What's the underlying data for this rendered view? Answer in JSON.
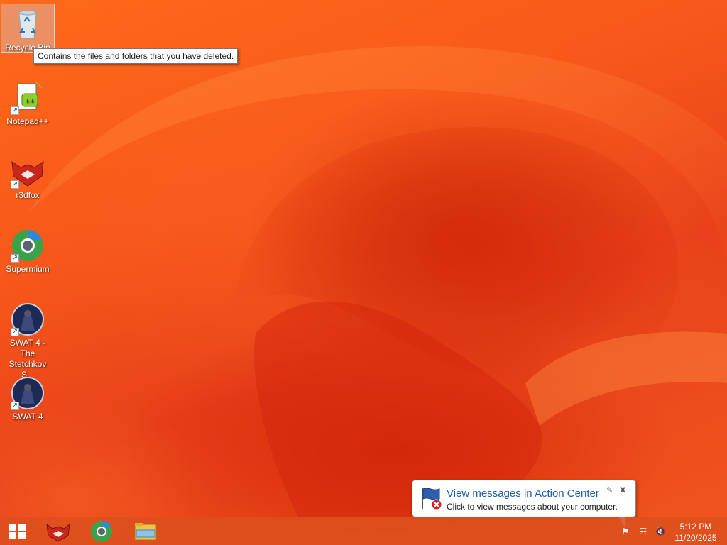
{
  "desktop": {
    "icons": [
      {
        "label": "Recycle Bin",
        "icon": "recycle-bin-icon",
        "selected": true
      },
      {
        "label": "Notepad++",
        "icon": "notepad-plus-plus-icon"
      },
      {
        "label": "r3dfox",
        "icon": "r3dfox-icon"
      },
      {
        "label": "Supermium",
        "icon": "supermium-icon"
      },
      {
        "label": "SWAT 4 - The Stetchkov S...",
        "icon": "swat4-icon"
      },
      {
        "label": "SWAT 4",
        "icon": "swat4-icon"
      }
    ],
    "tooltip": "Contains the files and folders that you have deleted."
  },
  "notification": {
    "title": "View messages in Action Center",
    "text": "Click to view messages about your computer.",
    "icon": "action-center-flag-icon",
    "close_glyph": "x"
  },
  "taskbar": {
    "start_icon": "windows-logo-icon",
    "pinned": [
      {
        "name": "r3dfox",
        "icon": "r3dfox-icon"
      },
      {
        "name": "Supermium",
        "icon": "supermium-icon"
      },
      {
        "name": "File Explorer",
        "icon": "file-explorer-icon"
      }
    ],
    "tray": [
      {
        "icon": "action-center-flag-icon"
      },
      {
        "icon": "network-icon"
      },
      {
        "icon": "volume-muted-icon"
      }
    ],
    "clock": {
      "time": "5:12 PM",
      "date": "11/20/2025"
    }
  },
  "colors": {
    "wallpaper_base": "#f7571a",
    "taskbar": "#dc501e",
    "balloon_title": "#1e5ea8"
  }
}
